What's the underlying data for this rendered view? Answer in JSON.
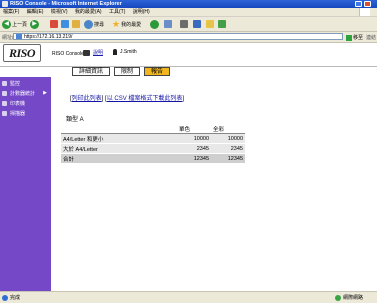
{
  "window": {
    "title": "RISO Console - Microsoft Internet Explorer"
  },
  "menu": [
    "檔案(F)",
    "編輯(E)",
    "檢視(V)",
    "我的最愛(A)",
    "工具(T)",
    "說明(H)"
  ],
  "toolbar": {
    "back": "上一頁",
    "search": "搜尋",
    "favorites": "我的最愛"
  },
  "address": {
    "label": "網址(D)",
    "url": "https://172.16.13.219/",
    "go": "移至",
    "links": "連結"
  },
  "header": {
    "logo": "RISO",
    "console_name": "RISO Console",
    "help": "說明",
    "user": "J.Smith"
  },
  "tabs": [
    "詳細資訊",
    "限制",
    "報告"
  ],
  "sidebar": {
    "items": [
      "監控",
      "計數器統計",
      "印表機",
      "掃描器"
    ]
  },
  "links": {
    "print": "列印此列表",
    "csv": "以 CSV 檔案格式下載此列表"
  },
  "report": {
    "title": "類型 A",
    "columns": [
      "",
      "單色",
      "全彩"
    ],
    "rows": [
      {
        "label": "A4/Letter 和更小",
        "mono": "10000",
        "color": "10000"
      },
      {
        "label": "大於 A4/Letter",
        "mono": "2345",
        "color": "2345"
      }
    ],
    "total": {
      "label": "合計",
      "mono": "12345",
      "color": "12345"
    }
  },
  "status": {
    "left": "完成",
    "zone": "網際網路"
  }
}
